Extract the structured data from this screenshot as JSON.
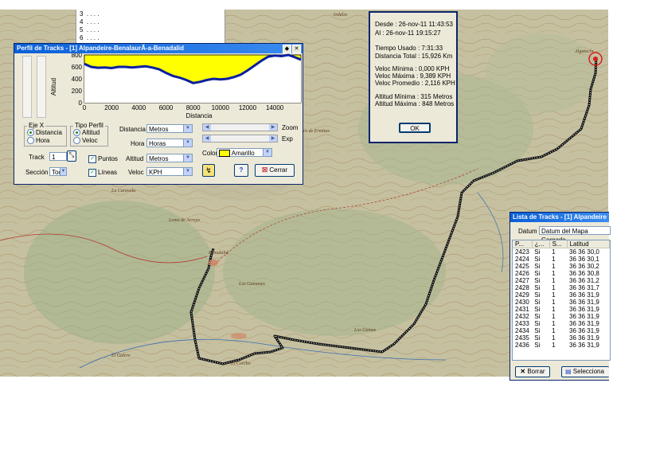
{
  "colors": {
    "profile_fill": "#ffff00",
    "profile_line": "#0a1fa0",
    "track": "#111111",
    "map_bg": "#c7c2a3",
    "title_bar": "#0a5fd8"
  },
  "top_list": {
    "rows": [
      "3",
      "4",
      "5",
      "6"
    ],
    "dots": ". . . ."
  },
  "map_labels": [
    "Benadalid",
    "Algatocín",
    "El Galero",
    "Cerro de Ermitas",
    "Los Gamanes",
    "Ardales",
    "Las Gamas",
    "La Caravela",
    "El Corcho",
    "Lomo de Arroyo"
  ],
  "profile": {
    "title": "Perfil de Tracks - [1] Alpandeire-BenalaurÃ-a-Benadalid",
    "chart_data": {
      "type": "area",
      "ylabel": "Altitud",
      "xlabel": "Distancia",
      "ylim": [
        0,
        800
      ],
      "xlim": [
        0,
        15926
      ],
      "yticks": [
        "0",
        "200",
        "400",
        "600",
        "800"
      ],
      "xticks": [
        "0",
        "2000",
        "4000",
        "6000",
        "8000",
        "10000",
        "12000",
        "14000"
      ],
      "x": [
        0,
        500,
        1000,
        1500,
        2000,
        2500,
        3000,
        3500,
        4000,
        4500,
        5000,
        5500,
        6000,
        6500,
        7000,
        7500,
        8000,
        8500,
        9000,
        9500,
        10000,
        10500,
        11000,
        11500,
        12000,
        12500,
        13000,
        13500,
        14000,
        14500,
        15000,
        15500,
        15926
      ],
      "values": [
        650,
        600,
        585,
        590,
        580,
        600,
        600,
        590,
        600,
        610,
        590,
        560,
        500,
        450,
        420,
        380,
        330,
        350,
        380,
        400,
        390,
        400,
        430,
        470,
        540,
        620,
        700,
        770,
        790,
        780,
        800,
        760,
        720
      ]
    },
    "eje_label": "Eje X",
    "eje_options": [
      "Distancia",
      "Hora"
    ],
    "tipo_label": "Tipo Perfil",
    "tipo_options": [
      "Altitud",
      "Veloc"
    ],
    "track_label": "Track",
    "track_value": "1",
    "seccion_label": "Sección",
    "seccion_value": "Tod",
    "puntos_label": "Puntos",
    "lineas_label": "Líneas",
    "distancia_label": "Distancia",
    "distancia_value": "Metros",
    "hora_label": "Hora",
    "hora_value": "Horas",
    "altitud_label": "Altitud",
    "altitud_value": "Metros",
    "veloc_label": "Veloc",
    "veloc_value": "KPH",
    "zoom_label": "Zoom",
    "exp_label": "Exp",
    "color_label": "Color",
    "color_value": "Amarillo",
    "help_glyph": "?",
    "cerrar_label": "Cerrar"
  },
  "stats": {
    "desde": "Desde : 26-nov-11 11:43:53",
    "al": "Al : 26-nov-11 19:15:27",
    "tiempo": "Tiempo Usado : 7:31:33",
    "distancia": "Distancia Total : 15,926 Km",
    "vmin": "Veloc Mínima : 0,000 KPH",
    "vmax": "Veloc Máxima : 9,389 KPH",
    "vprom": "Veloc Promedio : 2,116 KPH",
    "amin": "Altitud Mínima : 315 Metros",
    "amax": "Altitud Máxima : 848 Metros",
    "ok": "OK"
  },
  "lista": {
    "title": "Lista de Tracks - [1] Alpandeire",
    "datum_label": "Datum",
    "datum_value": "Datum del Mapa Cargado",
    "columns": [
      "P...",
      "¿...",
      "S...",
      "Latitud"
    ],
    "rows": [
      [
        "2423",
        "Si",
        "1",
        "36 36 30,0"
      ],
      [
        "2424",
        "Si",
        "1",
        "36 36 30,1"
      ],
      [
        "2425",
        "Si",
        "1",
        "36 36 30,2"
      ],
      [
        "2426",
        "Si",
        "1",
        "36 36 30,8"
      ],
      [
        "2427",
        "Si",
        "1",
        "36 36 31,2"
      ],
      [
        "2428",
        "Si",
        "1",
        "36 36 31,7"
      ],
      [
        "2429",
        "Si",
        "1",
        "36 36 31,9"
      ],
      [
        "2430",
        "Si",
        "1",
        "36 36 31,9"
      ],
      [
        "2431",
        "Si",
        "1",
        "36 36 31,9"
      ],
      [
        "2432",
        "Si",
        "1",
        "36 36 31,9"
      ],
      [
        "2433",
        "Si",
        "1",
        "36 36 31,9"
      ],
      [
        "2434",
        "Si",
        "1",
        "36 36 31,9"
      ],
      [
        "2435",
        "Si",
        "1",
        "36 36 31,9"
      ],
      [
        "2436",
        "Si",
        "1",
        "36 36 31,9"
      ]
    ],
    "borrar_label": "Borrar",
    "selecciona_label": "Selecciona"
  }
}
